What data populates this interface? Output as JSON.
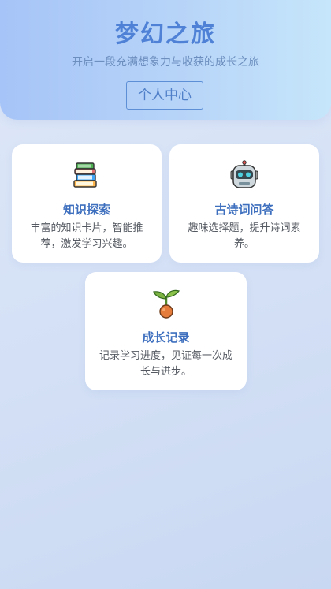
{
  "header": {
    "title": "梦幻之旅",
    "subtitle": "开启一段充满想象力与收获的成长之旅",
    "profile_button": "个人中心"
  },
  "cards": [
    {
      "icon": "books-icon",
      "title": "知识探索",
      "description": "丰富的知识卡片，智能推荐，激发学习兴趣。"
    },
    {
      "icon": "robot-icon",
      "title": "古诗词问答",
      "description": "趣味选择题，提升诗词素养。"
    },
    {
      "icon": "sprout-icon",
      "title": "成长记录",
      "description": "记录学习进度，见证每一次成长与进步。"
    }
  ],
  "colors": {
    "accent": "#4f82d6",
    "card_title": "#3e6fbf",
    "background": "#d2dff5"
  }
}
